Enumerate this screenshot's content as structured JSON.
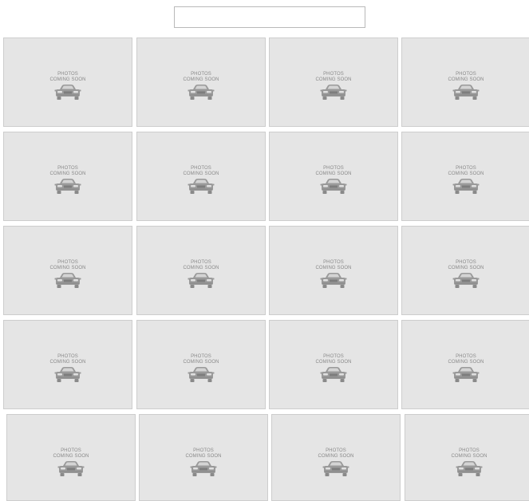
{
  "tile": {
    "line1": "PHOTOS",
    "line2": "COMING SOON",
    "icon": "car-icon"
  },
  "rows": 5,
  "columns": 4,
  "colors": {
    "tile_background": "#e5e5e5",
    "tile_border": "#cdcdcd",
    "placeholder_text": "#8a8a8a"
  }
}
